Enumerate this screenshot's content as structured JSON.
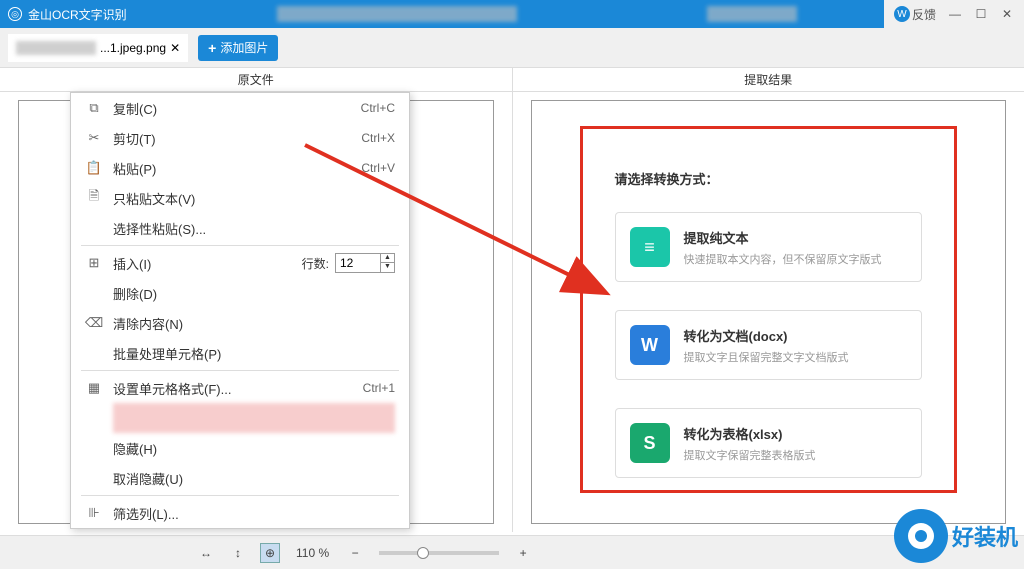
{
  "titlebar": {
    "app_name": "金山OCR文字识别",
    "feedback": "反馈"
  },
  "toolbar": {
    "tab_name": "...1.jpeg.png",
    "add_image": "添加图片"
  },
  "columns": {
    "left": "原文件",
    "right": "提取结果"
  },
  "context_menu": {
    "copy": "复制(C)",
    "copy_sc": "Ctrl+C",
    "cut": "剪切(T)",
    "cut_sc": "Ctrl+X",
    "paste": "粘贴(P)",
    "paste_sc": "Ctrl+V",
    "paste_text": "只粘贴文本(V)",
    "paste_special": "选择性粘贴(S)...",
    "insert": "插入(I)",
    "rows_label": "行数:",
    "rows_value": "12",
    "delete": "删除(D)",
    "clear": "清除内容(N)",
    "batch": "批量处理单元格(P)",
    "format": "设置单元格格式(F)...",
    "format_sc": "Ctrl+1",
    "hide": "隐藏(H)",
    "unhide": "取消隐藏(U)",
    "filter": "筛选列(L)..."
  },
  "result": {
    "heading": "请选择转换方式：",
    "options": [
      {
        "icon": "text",
        "title": "提取纯文本",
        "desc": "快速提取本文内容，但不保留原文字版式"
      },
      {
        "icon": "docx",
        "title": "转化为文档(docx)",
        "desc": "提取文字且保留完整文字文档版式"
      },
      {
        "icon": "xlsx",
        "title": "转化为表格(xlsx)",
        "desc": "提取文字保留完整表格版式"
      }
    ]
  },
  "statusbar": {
    "zoom": "110 %"
  },
  "watermark": {
    "text": "好装机"
  }
}
